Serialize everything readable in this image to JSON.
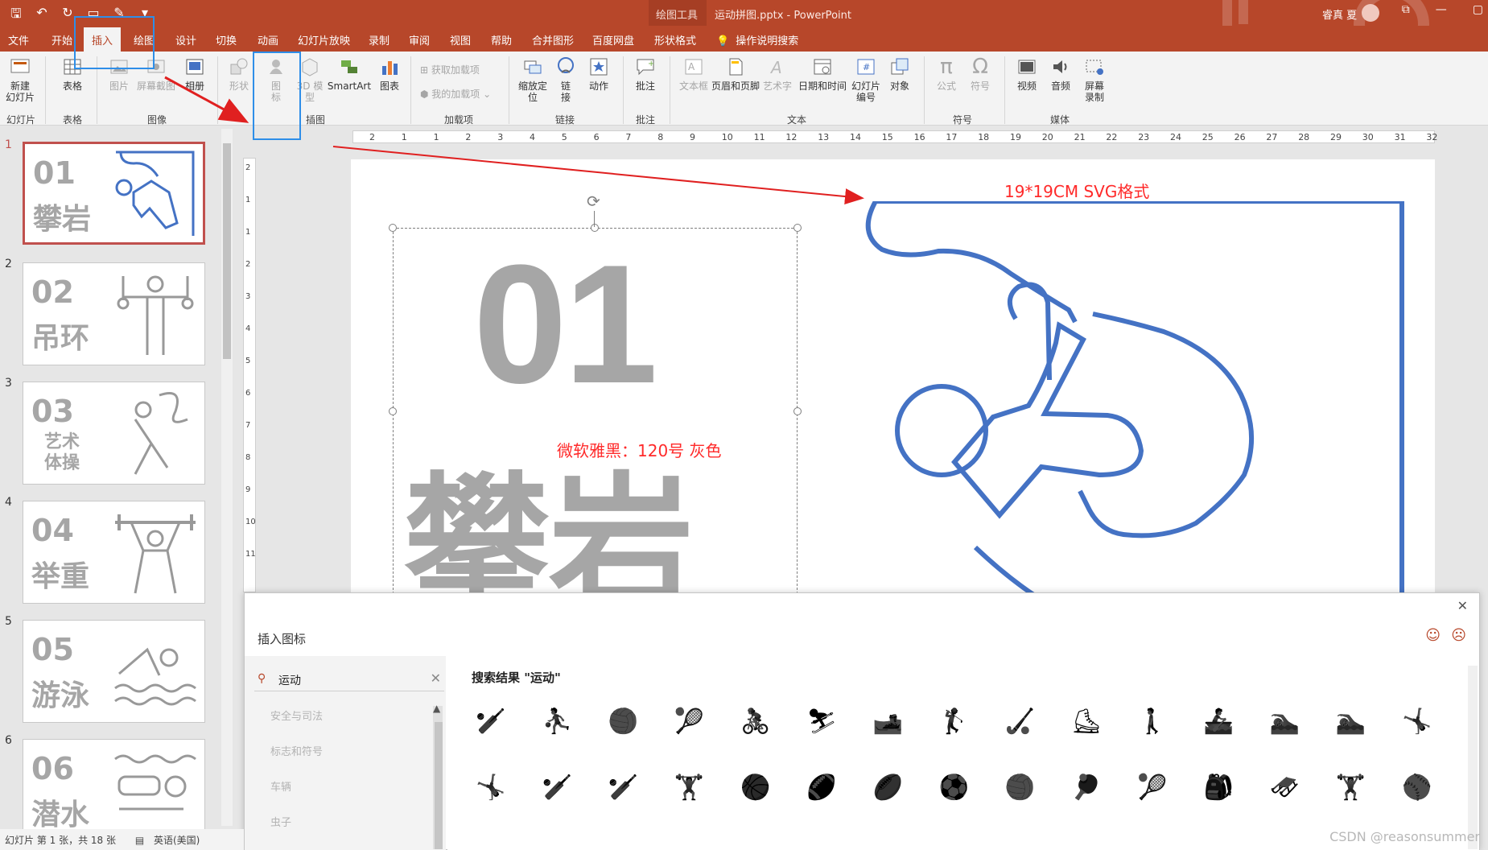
{
  "titlebar": {
    "context_tools": "绘图工具",
    "title": "运动拼图.pptx - PowerPoint",
    "user": "睿真 夏",
    "colors": {
      "accent": "#b7472a"
    }
  },
  "tabs": [
    {
      "label": "文件"
    },
    {
      "label": "开始"
    },
    {
      "label": "插入",
      "active": true
    },
    {
      "label": "绘图"
    },
    {
      "label": "设计"
    },
    {
      "label": "切换"
    },
    {
      "label": "动画"
    },
    {
      "label": "幻灯片放映"
    },
    {
      "label": "录制"
    },
    {
      "label": "审阅"
    },
    {
      "label": "视图"
    },
    {
      "label": "帮助"
    },
    {
      "label": "合并图形"
    },
    {
      "label": "百度网盘"
    },
    {
      "label": "形状格式"
    }
  ],
  "tellme": "操作说明搜索",
  "ribbon": {
    "new_slide": "新建\n幻灯片",
    "table": "表格",
    "picture": "图片",
    "screenshot": "屏幕截图",
    "album": "相册",
    "shapes": "形状",
    "icons": "图\n标",
    "models_3d": "3D 模\n型",
    "smartart": "SmartArt",
    "chart": "图表",
    "get_addins": "获取加载项",
    "my_addins": "我的加载项",
    "zoom": "缩放定\n位",
    "link": "链\n接",
    "action": "动作",
    "comment": "批注",
    "textbox": "文本框",
    "header_footer": "页眉和页脚",
    "wordart": "艺术字",
    "datetime": "日期和时间",
    "slide_number": "幻灯片\n编号",
    "object": "对象",
    "equation": "公式",
    "symbol": "符号",
    "video": "视频",
    "audio": "音频",
    "screen_record": "屏幕\n录制",
    "groups": {
      "slides": "幻灯片",
      "tables": "表格",
      "images": "图像",
      "illustrations": "插图",
      "addins": "加载项",
      "links": "链接",
      "comments": "批注",
      "text": "文本",
      "symbols": "符号",
      "media": "媒体"
    }
  },
  "ruler": {
    "h_ticks": [
      "2",
      "1",
      "1",
      "2",
      "3",
      "4",
      "5",
      "6",
      "7",
      "8",
      "9",
      "10",
      "11",
      "12",
      "13",
      "14",
      "15",
      "16",
      "17",
      "18",
      "19",
      "20",
      "21",
      "22",
      "23",
      "24",
      "25",
      "26",
      "27",
      "28",
      "29",
      "30",
      "31",
      "32"
    ],
    "v_ticks": [
      "2",
      "1",
      "1",
      "2",
      "3",
      "4",
      "5",
      "6",
      "7",
      "8",
      "9",
      "10",
      "11"
    ]
  },
  "slides": [
    {
      "num": "1",
      "code": "01",
      "name": "攀岩"
    },
    {
      "num": "2",
      "code": "02",
      "name": "吊环"
    },
    {
      "num": "3",
      "code": "03",
      "name": "艺术\n体操"
    },
    {
      "num": "4",
      "code": "04",
      "name": "举重"
    },
    {
      "num": "5",
      "code": "05",
      "name": "游泳"
    },
    {
      "num": "6",
      "code": "06",
      "name": "潜水"
    }
  ],
  "slide": {
    "big_number": "01",
    "big_name": "攀岩",
    "font_note": "微软雅黑：120号 灰色",
    "svg_note": "19*19CM SVG格式",
    "colors": {
      "gray": "#a6a6a6",
      "icon_blue": "#4472c4",
      "note_red": "#ff2a2a"
    }
  },
  "dialog": {
    "title": "插入图标",
    "search_value": "运动",
    "results_title": "搜索结果 \"运动\"",
    "categories": [
      "安全与司法",
      "标志和符号",
      "车辆",
      "虫子"
    ]
  },
  "status": {
    "slide_info": "幻灯片 第 1 张，共 18 张",
    "language": "英语(美国)"
  },
  "watermark": "CSDN @reasonsummer"
}
